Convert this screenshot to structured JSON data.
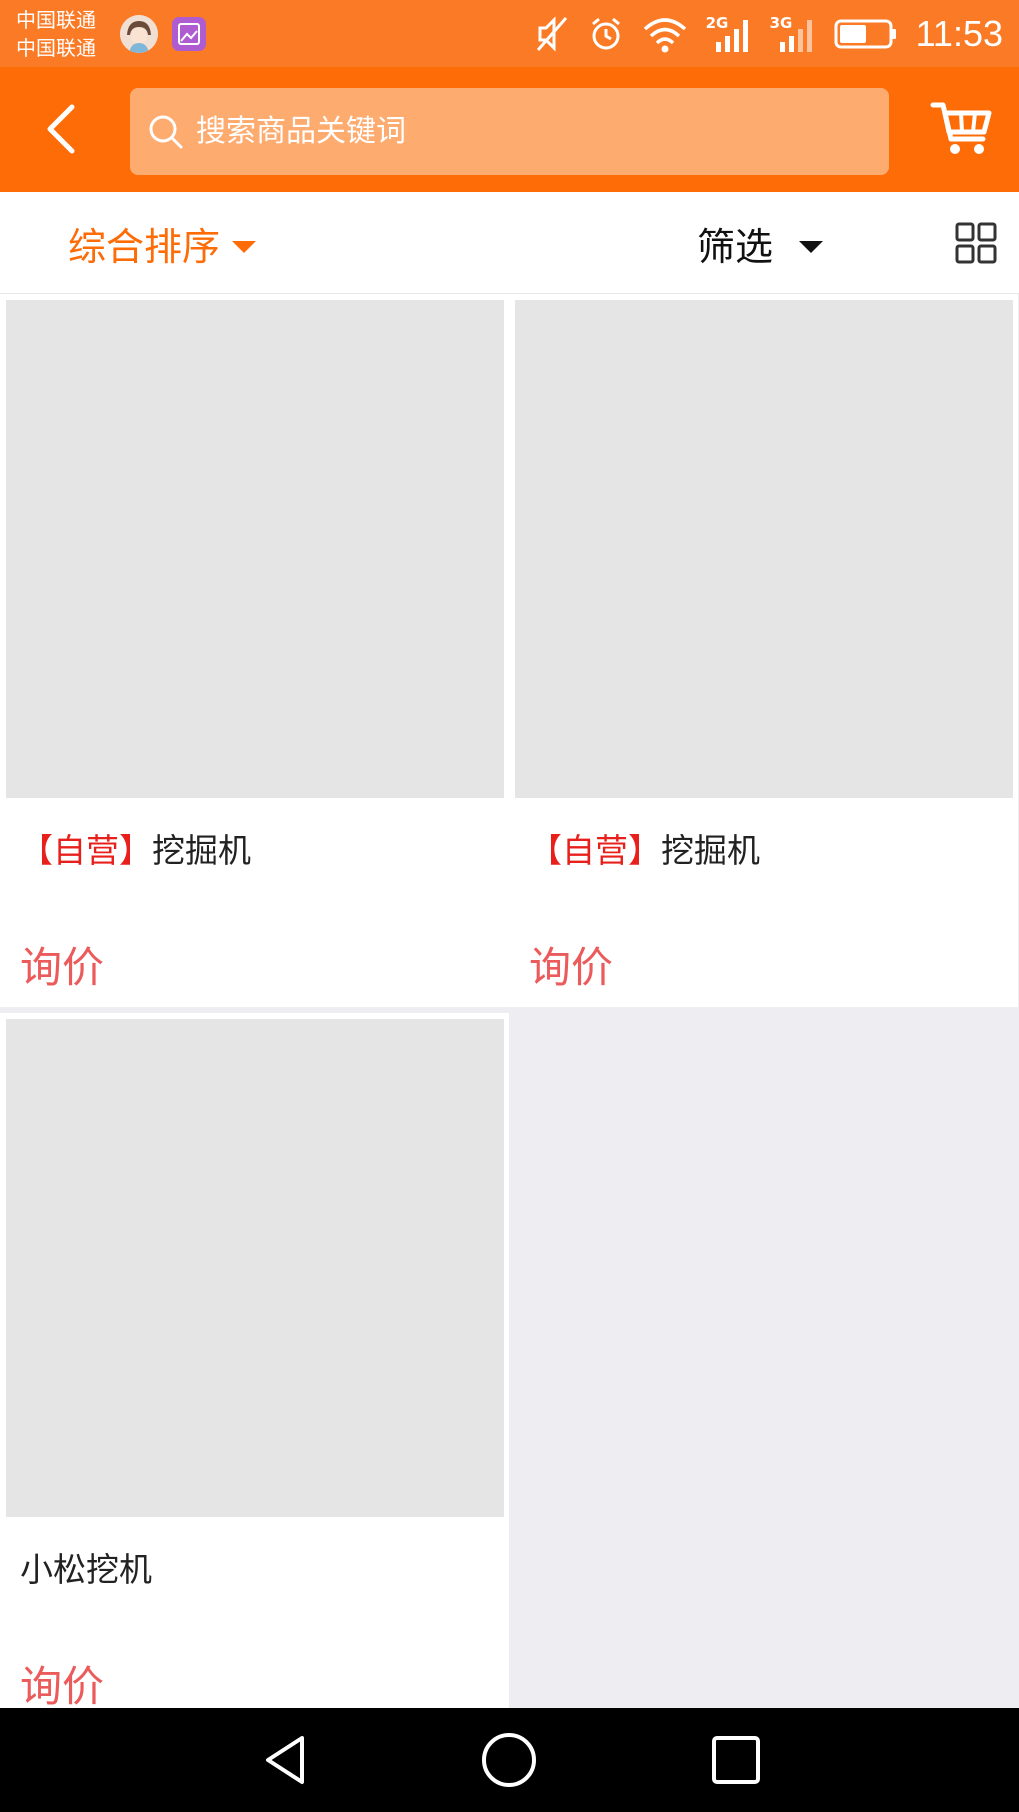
{
  "status_bar": {
    "carrier_1": "中国联通",
    "carrier_2": "中国联通",
    "net_1": "2G",
    "net_2": "3G",
    "time": "11:53"
  },
  "header": {
    "search_placeholder": "搜索商品关键词",
    "accent_color": "#fd6c06"
  },
  "sort_bar": {
    "sort_label": "综合排序",
    "filter_label": "筛选"
  },
  "products": [
    {
      "tag": "【自营】",
      "name": "挖掘机",
      "price": "询价"
    },
    {
      "tag": "【自营】",
      "name": "挖掘机",
      "price": "询价"
    },
    {
      "tag": "",
      "name": "小松挖机",
      "price": "询价"
    }
  ],
  "icons": {
    "back": "back-arrow-icon",
    "search": "search-icon",
    "cart": "cart-icon",
    "grid": "grid-view-icon",
    "nav_back": "triangle-back-icon",
    "nav_home": "circle-home-icon",
    "nav_recent": "square-recent-icon"
  }
}
